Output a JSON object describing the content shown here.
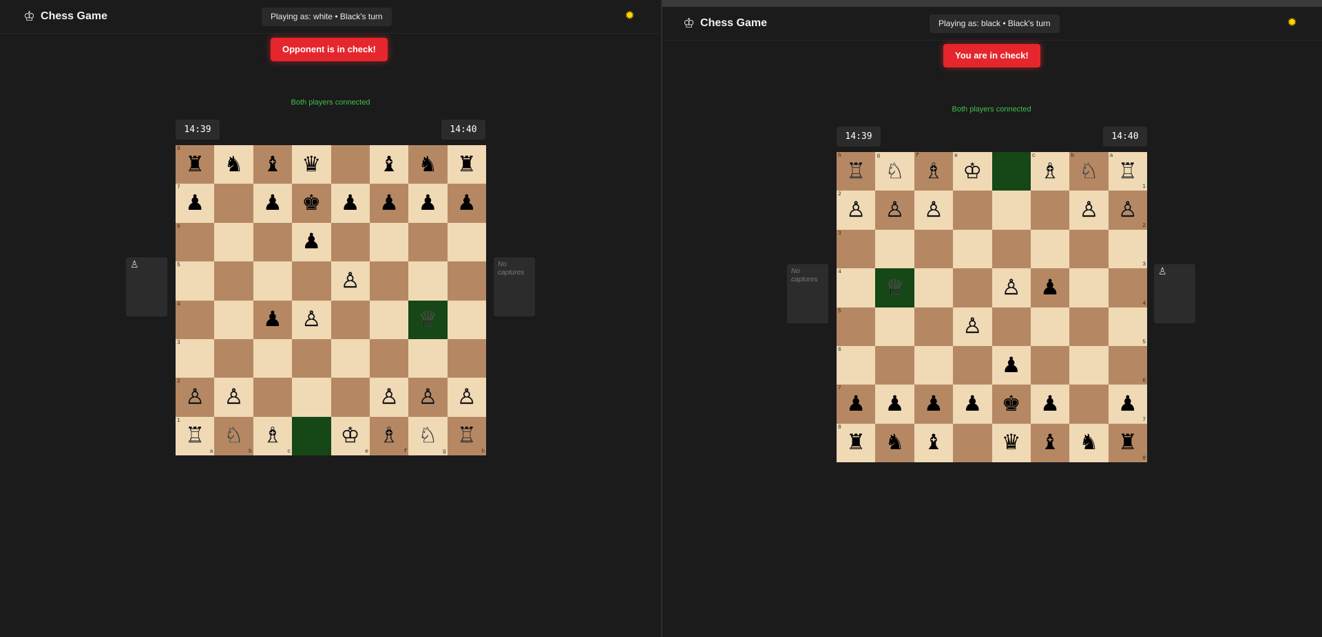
{
  "app_title": "Chess Game",
  "boards": {
    "left": {
      "status": "Playing as: white • Black's turn",
      "check_message": "Opponent is in check!",
      "connection": "Both players connected",
      "timer_left": "14:39",
      "timer_right": "14:40",
      "captures_left_pieces": "♙",
      "captures_right_text": "No captures",
      "orientation": "white",
      "highlight": [
        "d1",
        "g4"
      ]
    },
    "right": {
      "status": "Playing as: black • Black's turn",
      "check_message": "You are in check!",
      "connection": "Both players connected",
      "timer_left": "14:39",
      "timer_right": "14:40",
      "captures_left_text": "No captures",
      "captures_right_pieces": "♙",
      "orientation": "black",
      "highlight": [
        "d1",
        "g4"
      ]
    }
  },
  "position": {
    "a8": "bR",
    "b8": "bN",
    "c8": "bB",
    "d8": "bQ",
    "f8": "bB",
    "g8": "bN",
    "h8": "bR",
    "a7": "bP",
    "c7": "bP",
    "d7": "bK",
    "e7": "bP",
    "f7": "bP",
    "g7": "bP",
    "h7": "bP",
    "d6": "bP",
    "e5": "wP",
    "c4": "bP",
    "d4": "wP",
    "g4": "wQ",
    "a2": "wP",
    "b2": "wP",
    "f2": "wP",
    "g2": "wP",
    "h2": "wP",
    "a1": "wR",
    "b1": "wN",
    "c1": "wB",
    "e1": "wK",
    "f1": "wB",
    "g1": "wN",
    "h1": "wR"
  },
  "icons": {
    "app": "chess-king-icon",
    "theme": "sun-icon"
  },
  "colors": {
    "light_square": "#f0d9b5",
    "dark_square": "#b58863",
    "highlight_square": "#164716",
    "check_banner": "#e5272d",
    "connected_text": "#3fbf4f"
  }
}
